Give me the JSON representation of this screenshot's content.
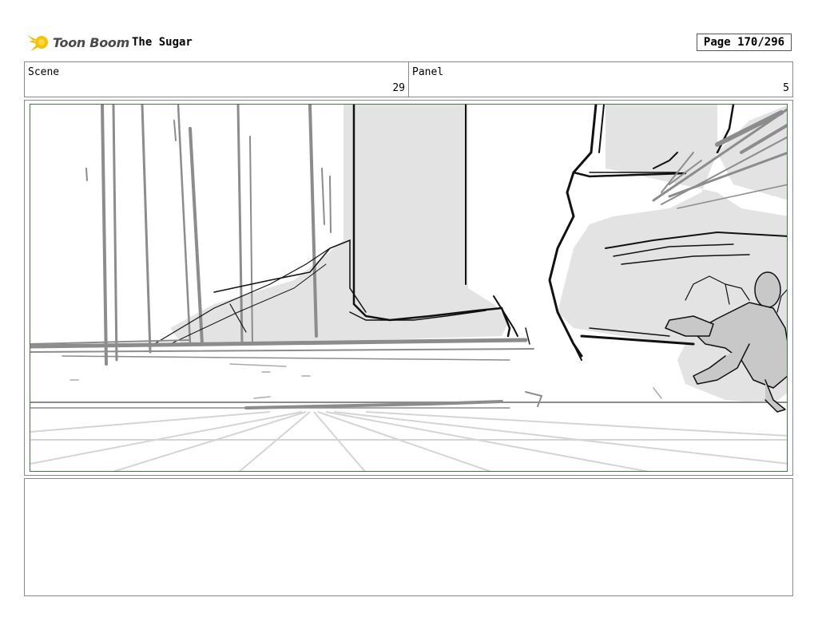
{
  "header": {
    "logo_text": "Toon Boom",
    "logo_icon": "toon-boom-star-icon",
    "title": "The Sugar",
    "page": "Page 170/296"
  },
  "info": {
    "scene_label": "Scene",
    "scene_value": "29",
    "panel_label": "Panel",
    "panel_value": "5"
  },
  "panel": {
    "border_color": "#3f7a3f",
    "fill_color": "#e3e3e3",
    "line_color": "#8c8c8c"
  },
  "notes": {}
}
